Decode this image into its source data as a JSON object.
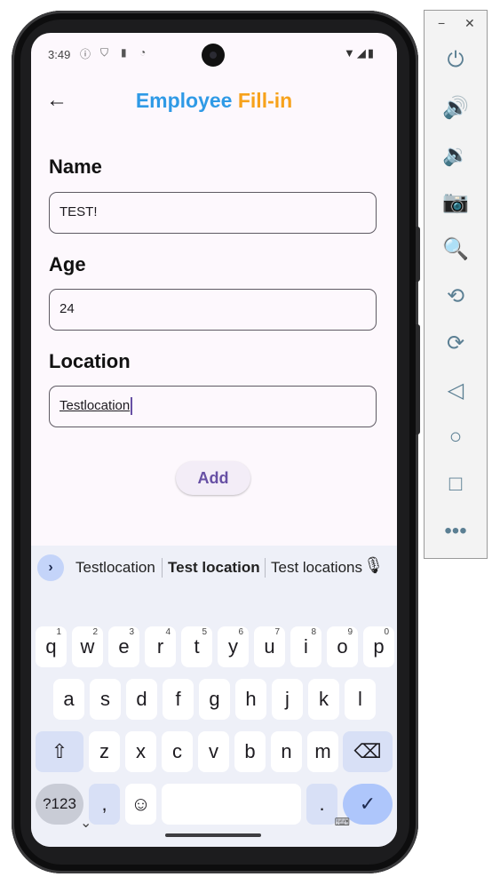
{
  "status_bar": {
    "time": "3:49",
    "icons": [
      "info-icon",
      "shield-icon",
      "sd-card-icon",
      "sync-icon"
    ],
    "right_icons": [
      "wifi-icon",
      "signal-icon",
      "battery-icon"
    ]
  },
  "app_bar": {
    "title_part1": "Employee",
    "title_part2": "Fill-in",
    "title_part1_color": "#2f9ae6",
    "title_part2_color": "#f7a21b"
  },
  "form": {
    "name_label": "Name",
    "name_value": "TEST!",
    "age_label": "Age",
    "age_value": "24",
    "location_label": "Location",
    "location_value": "Testlocation",
    "add_label": "Add"
  },
  "keyboard": {
    "suggestions": [
      "Testlocation",
      "Test location",
      "Test locations"
    ],
    "row1": [
      {
        "k": "q",
        "h": "1"
      },
      {
        "k": "w",
        "h": "2"
      },
      {
        "k": "e",
        "h": "3"
      },
      {
        "k": "r",
        "h": "4"
      },
      {
        "k": "t",
        "h": "5"
      },
      {
        "k": "y",
        "h": "6"
      },
      {
        "k": "u",
        "h": "7"
      },
      {
        "k": "i",
        "h": "8"
      },
      {
        "k": "o",
        "h": "9"
      },
      {
        "k": "p",
        "h": "0"
      }
    ],
    "row2": [
      "a",
      "s",
      "d",
      "f",
      "g",
      "h",
      "j",
      "k",
      "l"
    ],
    "row3": [
      "z",
      "x",
      "c",
      "v",
      "b",
      "n",
      "m"
    ],
    "symbols_label": "?123",
    "comma": ",",
    "period": "."
  },
  "accent_color": "#6750a4"
}
